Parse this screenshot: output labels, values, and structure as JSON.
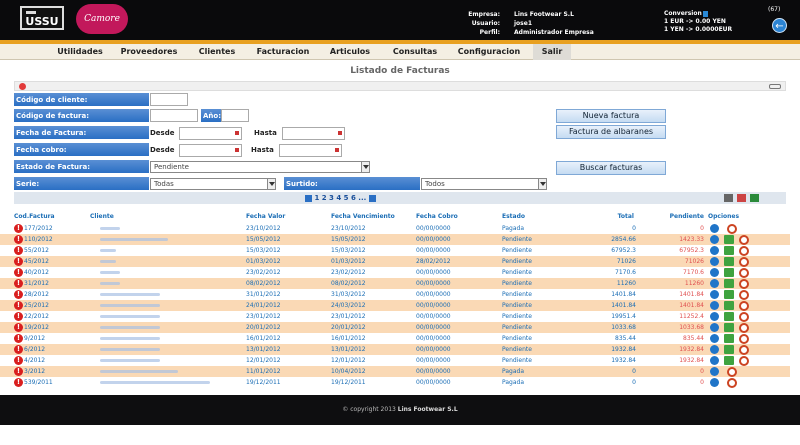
{
  "header": {
    "logo_text": "USSU",
    "brand_text": "Camore",
    "empresa_label": "Empresa:",
    "empresa_value": "Lins Footwear S.L",
    "usuario_label": "Usuario:",
    "usuario_value": "jose1",
    "perfil_label": "Perfil:",
    "perfil_value": "Administrador Empresa",
    "conversion_label": "Conversion",
    "conversion_line1": "1 EUR -> 0.00 YEN",
    "conversion_line2": "1 YEN -> 0.0000EUR",
    "notification_count": "(67)"
  },
  "menu": {
    "items": [
      "Utilidades",
      "Proveedores",
      "Clientes",
      "Facturacion",
      "Articulos",
      "Consultas",
      "Configuracion",
      "Salir"
    ]
  },
  "panel": {
    "title": "Listado de Facturas"
  },
  "filters": {
    "codigo_cliente": "Código de cliente:",
    "codigo_factura": "Código de factura:",
    "anio": "Año:",
    "fecha_factura": "Fecha de Factura:",
    "fecha_cobro": "Fecha cobro:",
    "estado_factura": "Estado de Factura:",
    "serie": "Serie:",
    "surtido": "Surtido:",
    "desde": "Desde",
    "hasta": "Hasta",
    "estado_value": "Pendiente",
    "serie_value": "Todas",
    "surtido_value": "Todos"
  },
  "buttons": {
    "nueva_factura": "Nueva factura",
    "factura_albaranes": "Factura de albaranes",
    "buscar_facturas": "Buscar facturas"
  },
  "pager": {
    "pages": "1 2 3 4 5 6 ..."
  },
  "table": {
    "headers": [
      "Cod.Factura",
      "Cliente",
      "Fecha Valor",
      "Fecha Vencimiento",
      "Fecha Cobro",
      "Estado",
      "Total",
      "Pendiente",
      "Opciones"
    ],
    "rows": [
      {
        "code": "177/2012",
        "valor": "23/10/2012",
        "venc": "23/10/2012",
        "cobro": "00/00/0000",
        "estado": "Pagada",
        "total": "0",
        "pend": "0"
      },
      {
        "code": "110/2012",
        "valor": "15/05/2012",
        "venc": "15/05/2012",
        "cobro": "00/00/0000",
        "estado": "Pendiente",
        "total": "2854.66",
        "pend": "1423.33"
      },
      {
        "code": "55/2012",
        "valor": "15/03/2012",
        "venc": "15/03/2012",
        "cobro": "00/00/0000",
        "estado": "Pendiente",
        "total": "67952.3",
        "pend": "67952.3"
      },
      {
        "code": "45/2012",
        "valor": "01/03/2012",
        "venc": "01/03/2012",
        "cobro": "28/02/2012",
        "estado": "Pendiente",
        "total": "71026",
        "pend": "71026"
      },
      {
        "code": "40/2012",
        "valor": "23/02/2012",
        "venc": "23/02/2012",
        "cobro": "00/00/0000",
        "estado": "Pendiente",
        "total": "7170.6",
        "pend": "7170.6"
      },
      {
        "code": "31/2012",
        "valor": "08/02/2012",
        "venc": "08/02/2012",
        "cobro": "00/00/0000",
        "estado": "Pendiente",
        "total": "11260",
        "pend": "11260"
      },
      {
        "code": "28/2012",
        "valor": "31/01/2012",
        "venc": "31/03/2012",
        "cobro": "00/00/0000",
        "estado": "Pendiente",
        "total": "1401.84",
        "pend": "1401.84"
      },
      {
        "code": "25/2012",
        "valor": "24/01/2012",
        "venc": "24/03/2012",
        "cobro": "00/00/0000",
        "estado": "Pendiente",
        "total": "1401.84",
        "pend": "1401.84"
      },
      {
        "code": "22/2012",
        "valor": "23/01/2012",
        "venc": "23/01/2012",
        "cobro": "00/00/0000",
        "estado": "Pendiente",
        "total": "19951.4",
        "pend": "11252.4"
      },
      {
        "code": "19/2012",
        "valor": "20/01/2012",
        "venc": "20/01/2012",
        "cobro": "00/00/0000",
        "estado": "Pendiente",
        "total": "1033.68",
        "pend": "1033.68"
      },
      {
        "code": "9/2012",
        "valor": "16/01/2012",
        "venc": "16/01/2012",
        "cobro": "00/00/0000",
        "estado": "Pendiente",
        "total": "835.44",
        "pend": "835.44"
      },
      {
        "code": "6/2012",
        "valor": "13/01/2012",
        "venc": "13/01/2012",
        "cobro": "00/00/0000",
        "estado": "Pendiente",
        "total": "1932.84",
        "pend": "1932.84"
      },
      {
        "code": "4/2012",
        "valor": "12/01/2012",
        "venc": "12/01/2012",
        "cobro": "00/00/0000",
        "estado": "Pendiente",
        "total": "1932.84",
        "pend": "1932.84"
      },
      {
        "code": "3/2012",
        "valor": "11/01/2012",
        "venc": "10/04/2012",
        "cobro": "00/00/0000",
        "estado": "Pagada",
        "total": "0",
        "pend": "0"
      },
      {
        "code": "539/2011",
        "valor": "19/12/2011",
        "venc": "19/12/2011",
        "cobro": "00/00/0000",
        "estado": "Pagada",
        "total": "0",
        "pend": "0"
      }
    ]
  },
  "footer": {
    "prefix": "© copyright 2013",
    "company": "Lins Footwear S.L"
  },
  "colors": {
    "accent": "#e8a020",
    "link": "#1a6db5",
    "pending": "#e05050",
    "row_alt": "#fad9b5"
  }
}
